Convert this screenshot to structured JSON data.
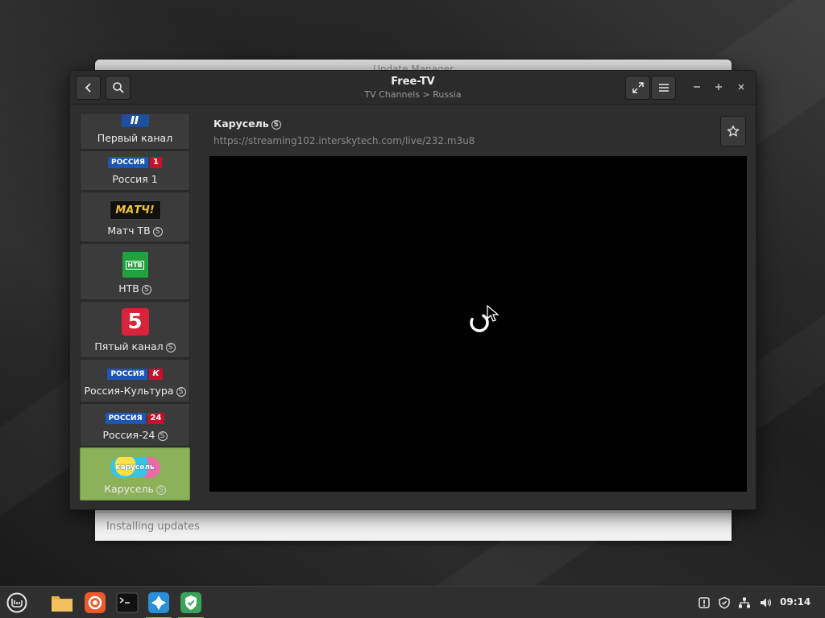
{
  "background_window": {
    "title": "Update Manager",
    "status": "Installing updates"
  },
  "window": {
    "title": "Free-TV",
    "subtitle": "TV Channels > Russia"
  },
  "channels": [
    {
      "name": "Первый канал",
      "stream": false
    },
    {
      "name": "Россия 1",
      "stream": false
    },
    {
      "name": "Матч ТВ",
      "stream": true
    },
    {
      "name": "НТВ",
      "stream": true
    },
    {
      "name": "Пятый канал",
      "stream": true
    },
    {
      "name": "Россия-Культура",
      "stream": true
    },
    {
      "name": "Россия-24",
      "stream": true
    },
    {
      "name": "Карусель",
      "stream": true,
      "active": true
    }
  ],
  "logos": {
    "rossia": "РОССИЯ",
    "rossia1_num": "1",
    "kultura_mark": "К",
    "rossia24_num": "24",
    "match": "МАТЧ!",
    "ntv": "НТВ",
    "five": "5",
    "karusel": "карусель"
  },
  "stream_flag": "S",
  "current": {
    "title": "Карусель",
    "url": "https://streaming102.interskytech.com/live/232.m3u8"
  },
  "taskbar": {
    "clock": "09:14"
  },
  "colors": {
    "accent": "#8bb159",
    "video_bg": "#000000"
  }
}
